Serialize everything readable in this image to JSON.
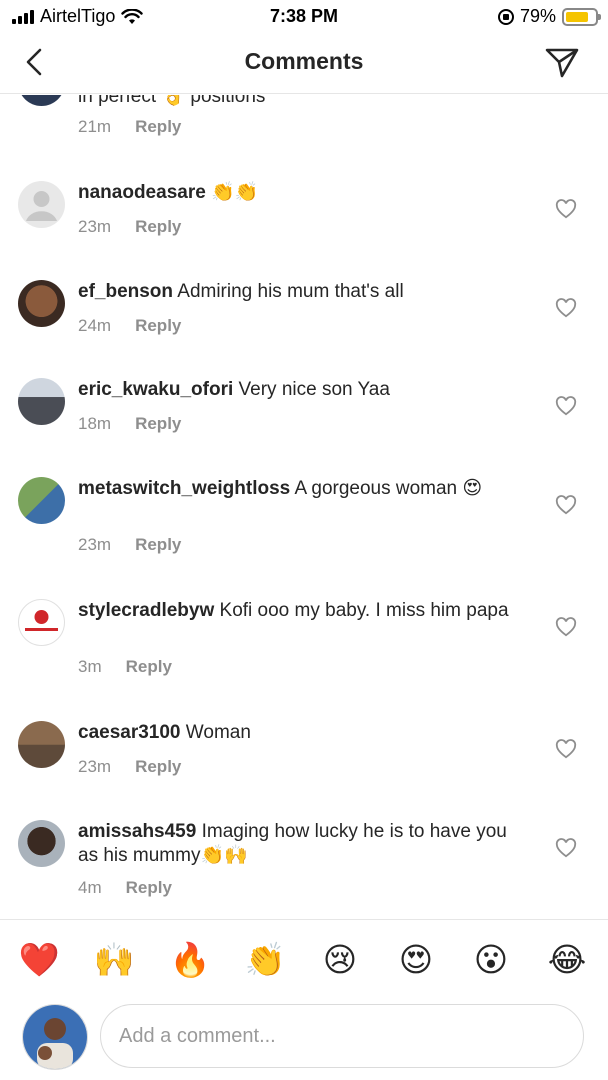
{
  "status_bar": {
    "carrier": "AirtelTigo",
    "time": "7:38 PM",
    "battery_percent": "79%",
    "battery_level": 0.79,
    "battery_color": "#f5c400"
  },
  "header": {
    "title": "Comments",
    "back_icon": "chevron-left-icon",
    "send_icon": "paper-plane-icon"
  },
  "partial_comment": {
    "text_start": "in perfect",
    "emoji": "👌",
    "text_end": "positions",
    "time": "21m",
    "reply_label": "Reply"
  },
  "comments": [
    {
      "username": "nanaodeasare",
      "text": "👏👏",
      "time": "23m",
      "reply_label": "Reply"
    },
    {
      "username": "ef_benson",
      "text": "Admiring his mum that's all",
      "time": "24m",
      "reply_label": "Reply"
    },
    {
      "username": "eric_kwaku_ofori",
      "text": "Very nice son Yaa",
      "time": "18m",
      "reply_label": "Reply"
    },
    {
      "username": "metaswitch_weightloss",
      "text": "A gorgeous woman 😍",
      "time": "23m",
      "reply_label": "Reply"
    },
    {
      "username": "stylecradlebyw",
      "text": "Kofi ooo my baby. I miss him papa",
      "time": "3m",
      "reply_label": "Reply"
    },
    {
      "username": "caesar3100",
      "text": "Woman",
      "time": "23m",
      "reply_label": "Reply"
    },
    {
      "username": "amissahs459",
      "text": "Imaging how lucky he is to have you as his mummy👏🙌",
      "time": "4m",
      "reply_label": "Reply"
    }
  ],
  "reactions": [
    "❤️",
    "🙌",
    "🔥",
    "👏",
    "😢",
    "😍",
    "😮",
    "😂"
  ],
  "composer": {
    "placeholder": "Add a comment..."
  },
  "colors": {
    "text": "#262626",
    "meta": "#8e8e8e",
    "divider": "#e6e6e6"
  }
}
